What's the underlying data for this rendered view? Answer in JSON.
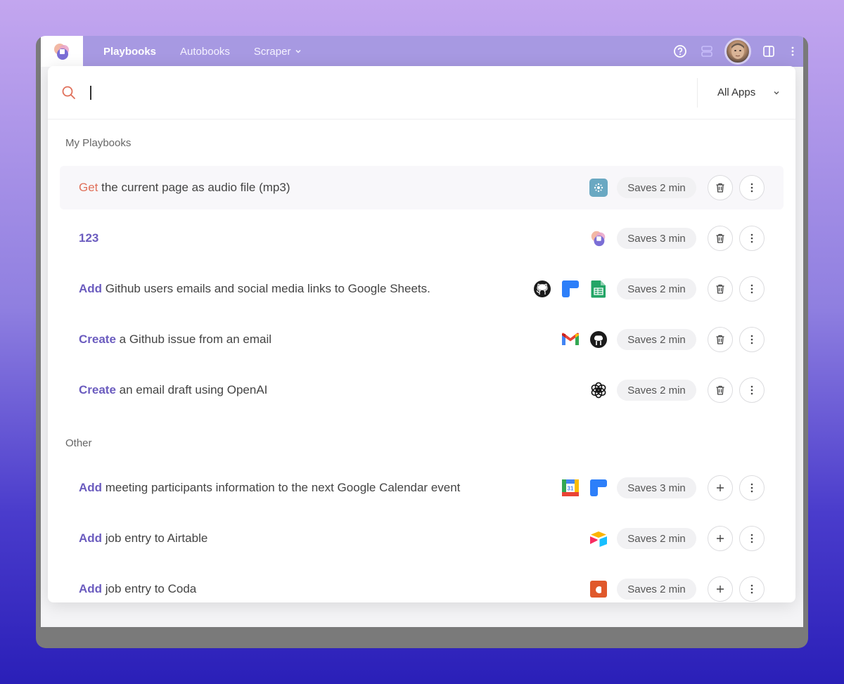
{
  "nav": {
    "items": [
      {
        "label": "Playbooks",
        "active": true
      },
      {
        "label": "Autobooks",
        "active": false
      },
      {
        "label": "Scraper",
        "active": false
      }
    ]
  },
  "search": {
    "value": "",
    "placeholder": "",
    "filter_label": "All Apps"
  },
  "sections": {
    "my_playbooks": "My Playbooks",
    "other": "Other"
  },
  "rows": [
    {
      "verb": "Get",
      "rest": " the current page as audio file (mp3)",
      "apps": [
        "speech-app-icon"
      ],
      "saves": "Saves 2 min",
      "action": "delete"
    },
    {
      "verb": "123",
      "rest": "",
      "apps": [
        "bardeen-app-icon"
      ],
      "saves": "Saves 3 min",
      "action": "delete"
    },
    {
      "verb": "Add",
      "rest": " Github users emails and social media links to Google Sheets.",
      "apps": [
        "github-app-icon",
        "scraper-app-icon",
        "google-sheets-app-icon"
      ],
      "saves": "Saves 2 min",
      "action": "delete"
    },
    {
      "verb": "Create",
      "rest": " a Github issue from an email",
      "apps": [
        "gmail-app-icon",
        "github-app-icon"
      ],
      "saves": "Saves 2 min",
      "action": "delete"
    },
    {
      "verb": "Create",
      "rest": " an email draft using OpenAI",
      "apps": [
        "openai-app-icon"
      ],
      "saves": "Saves 2 min",
      "action": "delete"
    },
    {
      "verb": "Add",
      "rest": " meeting participants information to the next Google Calendar event",
      "apps": [
        "google-calendar-app-icon",
        "scraper-app-icon"
      ],
      "saves": "Saves 3 min",
      "action": "add"
    },
    {
      "verb": "Add",
      "rest": " job entry to Airtable",
      "apps": [
        "airtable-app-icon"
      ],
      "saves": "Saves 2 min",
      "action": "add"
    },
    {
      "verb": "Add",
      "rest": " job entry to Coda",
      "apps": [
        "coda-app-icon"
      ],
      "saves": "Saves 2 min",
      "action": "add"
    }
  ],
  "calendar_day": "31",
  "colors": {
    "accent": "#6b5cbf",
    "highlight_verb": "#e0705a",
    "topbar": "#a799e2"
  }
}
